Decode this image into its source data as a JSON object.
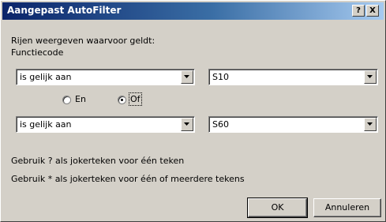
{
  "window": {
    "title": "Aangepast AutoFilter",
    "help_glyph": "?",
    "close_glyph": "X"
  },
  "dialog": {
    "instruction": "Rijen weergeven waarvoor geldt:",
    "field_name": "Functiecode",
    "criterion1": {
      "operator": "is gelijk aan",
      "value": "S10"
    },
    "logic": {
      "and_label": "En",
      "or_label": "Of",
      "selected": "Of"
    },
    "criterion2": {
      "operator": "is gelijk aan",
      "value": "S60"
    },
    "hint1": "Gebruik ? als jokerteken voor één teken",
    "hint2": "Gebruik * als jokerteken voor één of meerdere tekens"
  },
  "buttons": {
    "ok": "OK",
    "cancel": "Annuleren"
  }
}
